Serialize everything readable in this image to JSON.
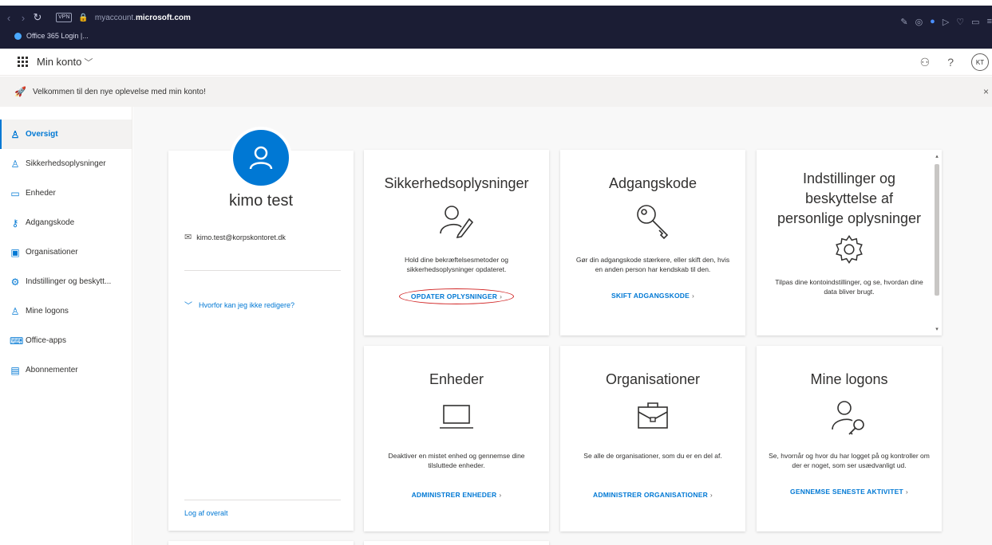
{
  "browser": {
    "vpn_label": "VPN",
    "url_prefix": "myaccount.",
    "url_domain": "microsoft.com",
    "tab_title": "Office 365 Login |..."
  },
  "header": {
    "app_title": "Min konto",
    "avatar_initials": "KT",
    "help": "?"
  },
  "banner": {
    "text": "Velkommen til den nye oplevelse med min konto!",
    "close": "×"
  },
  "sidebar": {
    "items": [
      {
        "label": "Oversigt",
        "icon": "person-icon"
      },
      {
        "label": "Sikkerhedsoplysninger",
        "icon": "security-info-icon"
      },
      {
        "label": "Enheder",
        "icon": "laptop-icon"
      },
      {
        "label": "Adgangskode",
        "icon": "key-icon"
      },
      {
        "label": "Organisationer",
        "icon": "briefcase-icon"
      },
      {
        "label": "Indstillinger og beskytt...",
        "icon": "gear-icon"
      },
      {
        "label": "Mine logons",
        "icon": "signin-icon"
      },
      {
        "label": "Office-apps",
        "icon": "apps-icon"
      },
      {
        "label": "Abonnementer",
        "icon": "card-icon"
      }
    ]
  },
  "profile": {
    "name": "kimo test",
    "email": "kimo.test@korpskontoret.dk",
    "why_link": "Hvorfor kan jeg ikke redigere?",
    "logoff": "Log af overalt"
  },
  "tiles": {
    "security": {
      "title": "Sikkerhedsoplysninger",
      "desc": "Hold dine bekræftelsesmetoder og sikkerhedsoplysninger opdateret.",
      "link": "OPDATER OPLYSNINGER"
    },
    "password": {
      "title": "Adgangskode",
      "desc": "Gør din adgangskode stærkere, eller skift den, hvis en anden person har kendskab til den.",
      "link": "SKIFT ADGANGSKODE"
    },
    "privacy": {
      "title": "Indstillinger og beskyttelse af personlige oplysninger",
      "desc": "Tilpas dine kontoindstillinger, og se, hvordan dine data bliver brugt."
    },
    "devices": {
      "title": "Enheder",
      "desc": "Deaktiver en mistet enhed og gennemse dine tilsluttede enheder.",
      "link": "ADMINISTRER ENHEDER"
    },
    "orgs": {
      "title": "Organisationer",
      "desc": "Se alle de organisationer, som du er en del af.",
      "link": "ADMINISTRER ORGANISATIONER"
    },
    "signins": {
      "title": "Mine logons",
      "desc": "Se, hvornår og hvor du har logget på og kontroller om der er noget, som ser usædvanligt ud.",
      "link": "GENNEMSE SENESTE AKTIVITET"
    }
  },
  "colors": {
    "accent": "#0078d4",
    "browser_bg": "#1b1d34",
    "highlight_circle": "#d02020"
  }
}
